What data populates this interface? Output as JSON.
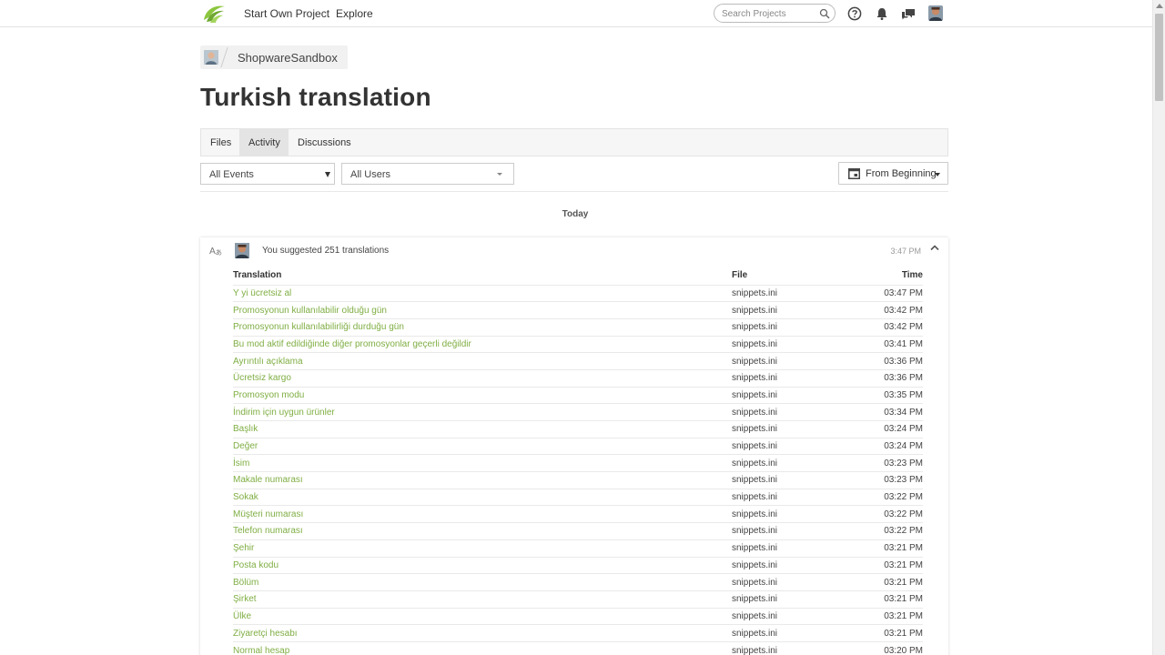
{
  "colors": {
    "accent": "#7fae43",
    "tab_active_bg": "#e4e4e4"
  },
  "topbar": {
    "logo_icon": "brand-leaf-logo",
    "nav": {
      "start_own_project": "Start Own Project",
      "explore": "Explore"
    },
    "search": {
      "placeholder": "Search Projects",
      "icon": "search-icon"
    },
    "icons": [
      "help-icon",
      "bell-icon",
      "chat-icon",
      "user-avatar"
    ]
  },
  "breadcrumb": {
    "project": "ShopwareSandbox"
  },
  "page": {
    "title": "Turkish translation"
  },
  "tabs": [
    {
      "label": "Files",
      "active": false
    },
    {
      "label": "Activity",
      "active": true
    },
    {
      "label": "Discussions",
      "active": false
    }
  ],
  "filters": {
    "events": "All Events",
    "users": "All Users",
    "range": "From Beginning"
  },
  "day_label": "Today",
  "activity": {
    "icon": "translate-icon",
    "summary": "You suggested 251 translations",
    "time": "3:47 PM",
    "columns": {
      "translation": "Translation",
      "file": "File",
      "time": "Time"
    },
    "rows": [
      {
        "translation": "Y yi ücretsiz al",
        "file": "snippets.ini",
        "time": "03:47 PM"
      },
      {
        "translation": "Promosyonun kullanılabilir olduğu gün",
        "file": "snippets.ini",
        "time": "03:42 PM"
      },
      {
        "translation": "Promosyonun kullanılabilirliği durduğu gün",
        "file": "snippets.ini",
        "time": "03:42 PM"
      },
      {
        "translation": "Bu mod aktif edildiğinde diğer promosyonlar geçerli değildir",
        "file": "snippets.ini",
        "time": "03:41 PM"
      },
      {
        "translation": "Ayrıntılı açıklama",
        "file": "snippets.ini",
        "time": "03:36 PM"
      },
      {
        "translation": "Ücretsiz kargo",
        "file": "snippets.ini",
        "time": "03:36 PM"
      },
      {
        "translation": "Promosyon modu",
        "file": "snippets.ini",
        "time": "03:35 PM"
      },
      {
        "translation": "İndirim için uygun ürünler",
        "file": "snippets.ini",
        "time": "03:34 PM"
      },
      {
        "translation": "Başlık",
        "file": "snippets.ini",
        "time": "03:24 PM"
      },
      {
        "translation": "Değer",
        "file": "snippets.ini",
        "time": "03:24 PM"
      },
      {
        "translation": "İsim",
        "file": "snippets.ini",
        "time": "03:23 PM"
      },
      {
        "translation": "Makale numarası",
        "file": "snippets.ini",
        "time": "03:23 PM"
      },
      {
        "translation": "Sokak",
        "file": "snippets.ini",
        "time": "03:22 PM"
      },
      {
        "translation": "Müşteri numarası",
        "file": "snippets.ini",
        "time": "03:22 PM"
      },
      {
        "translation": "Telefon numarası",
        "file": "snippets.ini",
        "time": "03:22 PM"
      },
      {
        "translation": "Şehir",
        "file": "snippets.ini",
        "time": "03:21 PM"
      },
      {
        "translation": "Posta kodu",
        "file": "snippets.ini",
        "time": "03:21 PM"
      },
      {
        "translation": "Bölüm",
        "file": "snippets.ini",
        "time": "03:21 PM"
      },
      {
        "translation": "Şirket",
        "file": "snippets.ini",
        "time": "03:21 PM"
      },
      {
        "translation": "Ülke",
        "file": "snippets.ini",
        "time": "03:21 PM"
      },
      {
        "translation": "Ziyaretçi hesabı",
        "file": "snippets.ini",
        "time": "03:21 PM"
      },
      {
        "translation": "Normal hesap",
        "file": "snippets.ini",
        "time": "03:20 PM"
      }
    ]
  }
}
